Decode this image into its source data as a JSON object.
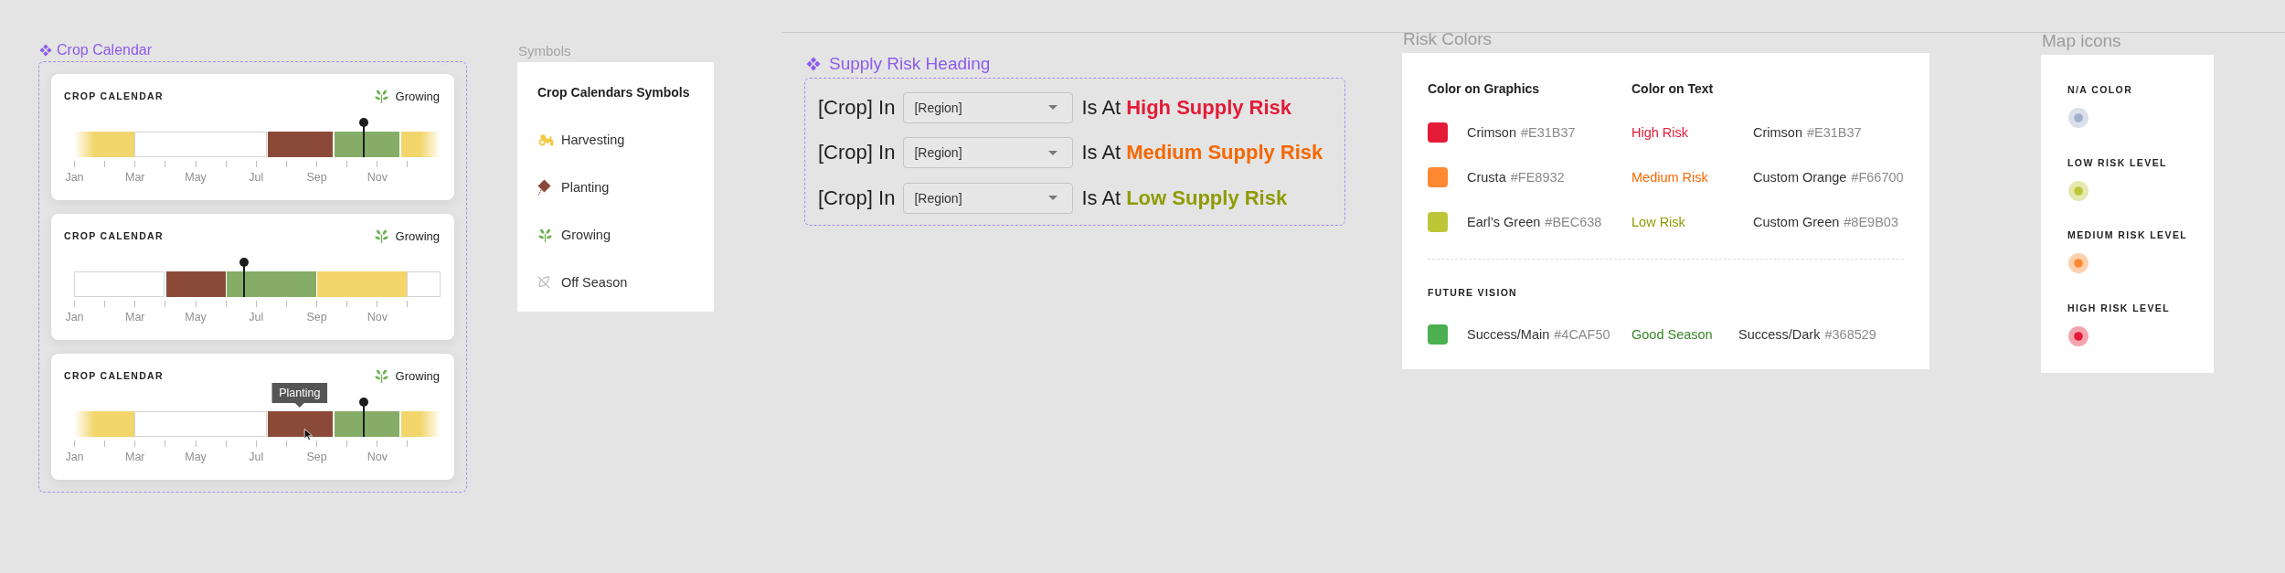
{
  "crop_calendar": {
    "title": "Crop Calendar",
    "cards": [
      {
        "title": "CROP CALENDAR",
        "status": {
          "kind": "growing",
          "label": "Growing"
        },
        "segments": [
          {
            "kind": "harvesting",
            "color": "#f2d56b"
          },
          {
            "kind": "off_season",
            "color": "#ffffff"
          },
          {
            "kind": "planting",
            "color": "#8b4a38"
          },
          {
            "kind": "growing",
            "color": "#86ad68"
          },
          {
            "kind": "harvesting",
            "color": "#f2d56b"
          }
        ],
        "marker": {
          "level": 0.791
        },
        "months": [
          "Jan",
          "Mar",
          "May",
          "Jul",
          "Sep",
          "Nov"
        ]
      },
      {
        "title": "CROP CALENDAR",
        "status": {
          "kind": "growing",
          "label": "Growing"
        },
        "segments": [
          {
            "kind": "off_season",
            "color": "#ffffff"
          },
          {
            "kind": "planting",
            "color": "#8b4a38"
          },
          {
            "kind": "growing",
            "color": "#86ad68"
          },
          {
            "kind": "harvesting",
            "color": "#f2d56b"
          },
          {
            "kind": "off_season",
            "color": "#ffffff"
          }
        ],
        "marker": {
          "level": 0.464
        },
        "months": [
          "Jan",
          "Mar",
          "May",
          "Jul",
          "Sep",
          "Nov"
        ]
      },
      {
        "title": "CROP CALENDAR",
        "status": {
          "kind": "growing",
          "label": "Growing"
        },
        "segments": [
          {
            "kind": "harvesting",
            "color": "#f2d56b"
          },
          {
            "kind": "off_season",
            "color": "#ffffff"
          },
          {
            "kind": "planting",
            "color": "#8b4a38",
            "tooltip": "Planting"
          },
          {
            "kind": "growing",
            "color": "#86ad68"
          },
          {
            "kind": "harvesting",
            "color": "#f2d56b"
          }
        ],
        "marker": {
          "level": 0.791
        },
        "months": [
          "Jan",
          "Mar",
          "May",
          "Jul",
          "Sep",
          "Nov"
        ]
      }
    ]
  },
  "symbols": {
    "title": "Symbols",
    "heading": "Crop Calendars Symbols",
    "items": [
      {
        "kind": "harvesting",
        "label": "Harvesting"
      },
      {
        "kind": "planting",
        "label": "Planting"
      },
      {
        "kind": "growing",
        "label": "Growing"
      },
      {
        "kind": "off_season",
        "label": "Off Season"
      }
    ]
  },
  "supply_risk": {
    "title": "Supply Risk Heading",
    "rows": [
      {
        "crop": "[Crop] In",
        "region": "[Region]",
        "connector": "Is At",
        "risk": "High Supply Risk",
        "color": "#e31b37"
      },
      {
        "crop": "[Crop] In",
        "region": "[Region]",
        "connector": "Is At",
        "risk": "Medium Supply Risk",
        "color": "#f66700"
      },
      {
        "crop": "[Crop] In",
        "region": "[Region]",
        "connector": "Is At",
        "risk": "Low Supply Risk",
        "color": "#8e9b03"
      }
    ]
  },
  "risk_colors": {
    "title": "Risk Colors",
    "headers": [
      "Color on Graphics",
      "Color on Text"
    ],
    "rows": [
      {
        "color": "#e31b37",
        "name": "Crimson",
        "hex": "#E31B37",
        "sample": {
          "text": "High Risk",
          "color": "#e31b37"
        },
        "text_swatch": {
          "name": "Crimson",
          "hex": "#E31B37"
        }
      },
      {
        "color": "#fe8932",
        "name": "Crusta",
        "hex": "#FE8932",
        "sample": {
          "text": "Medium Risk",
          "color": "#f66700"
        },
        "text_swatch": {
          "name": "Custom Orange",
          "hex": "#F66700"
        }
      },
      {
        "color": "#bec638",
        "name": "Earl’s Green",
        "hex": "#BEC638",
        "sample": {
          "text": "Low Risk",
          "color": "#8e9b03"
        },
        "text_swatch": {
          "name": "Custom Green",
          "hex": "#8E9B03"
        }
      }
    ],
    "future": {
      "title": "FUTURE VISION",
      "rows": [
        {
          "color": "#4caf50",
          "name": "Success/Main",
          "hex": "#4CAF50",
          "sample": {
            "text": "Good Season",
            "color": "#368529"
          },
          "text_swatch": {
            "name": "Success/Dark",
            "hex": "#368529"
          }
        }
      ]
    }
  },
  "map_icons": {
    "title": "Map icons",
    "items": [
      {
        "label": "N/A COLOR",
        "color": "#9fb0cc"
      },
      {
        "label": "LOW RISK LEVEL",
        "color": "#bec638"
      },
      {
        "label": "MEDIUM RISK LEVEL",
        "color": "#fe8932"
      },
      {
        "label": "HIGH RISK LEVEL",
        "color": "#e31b37"
      }
    ]
  }
}
